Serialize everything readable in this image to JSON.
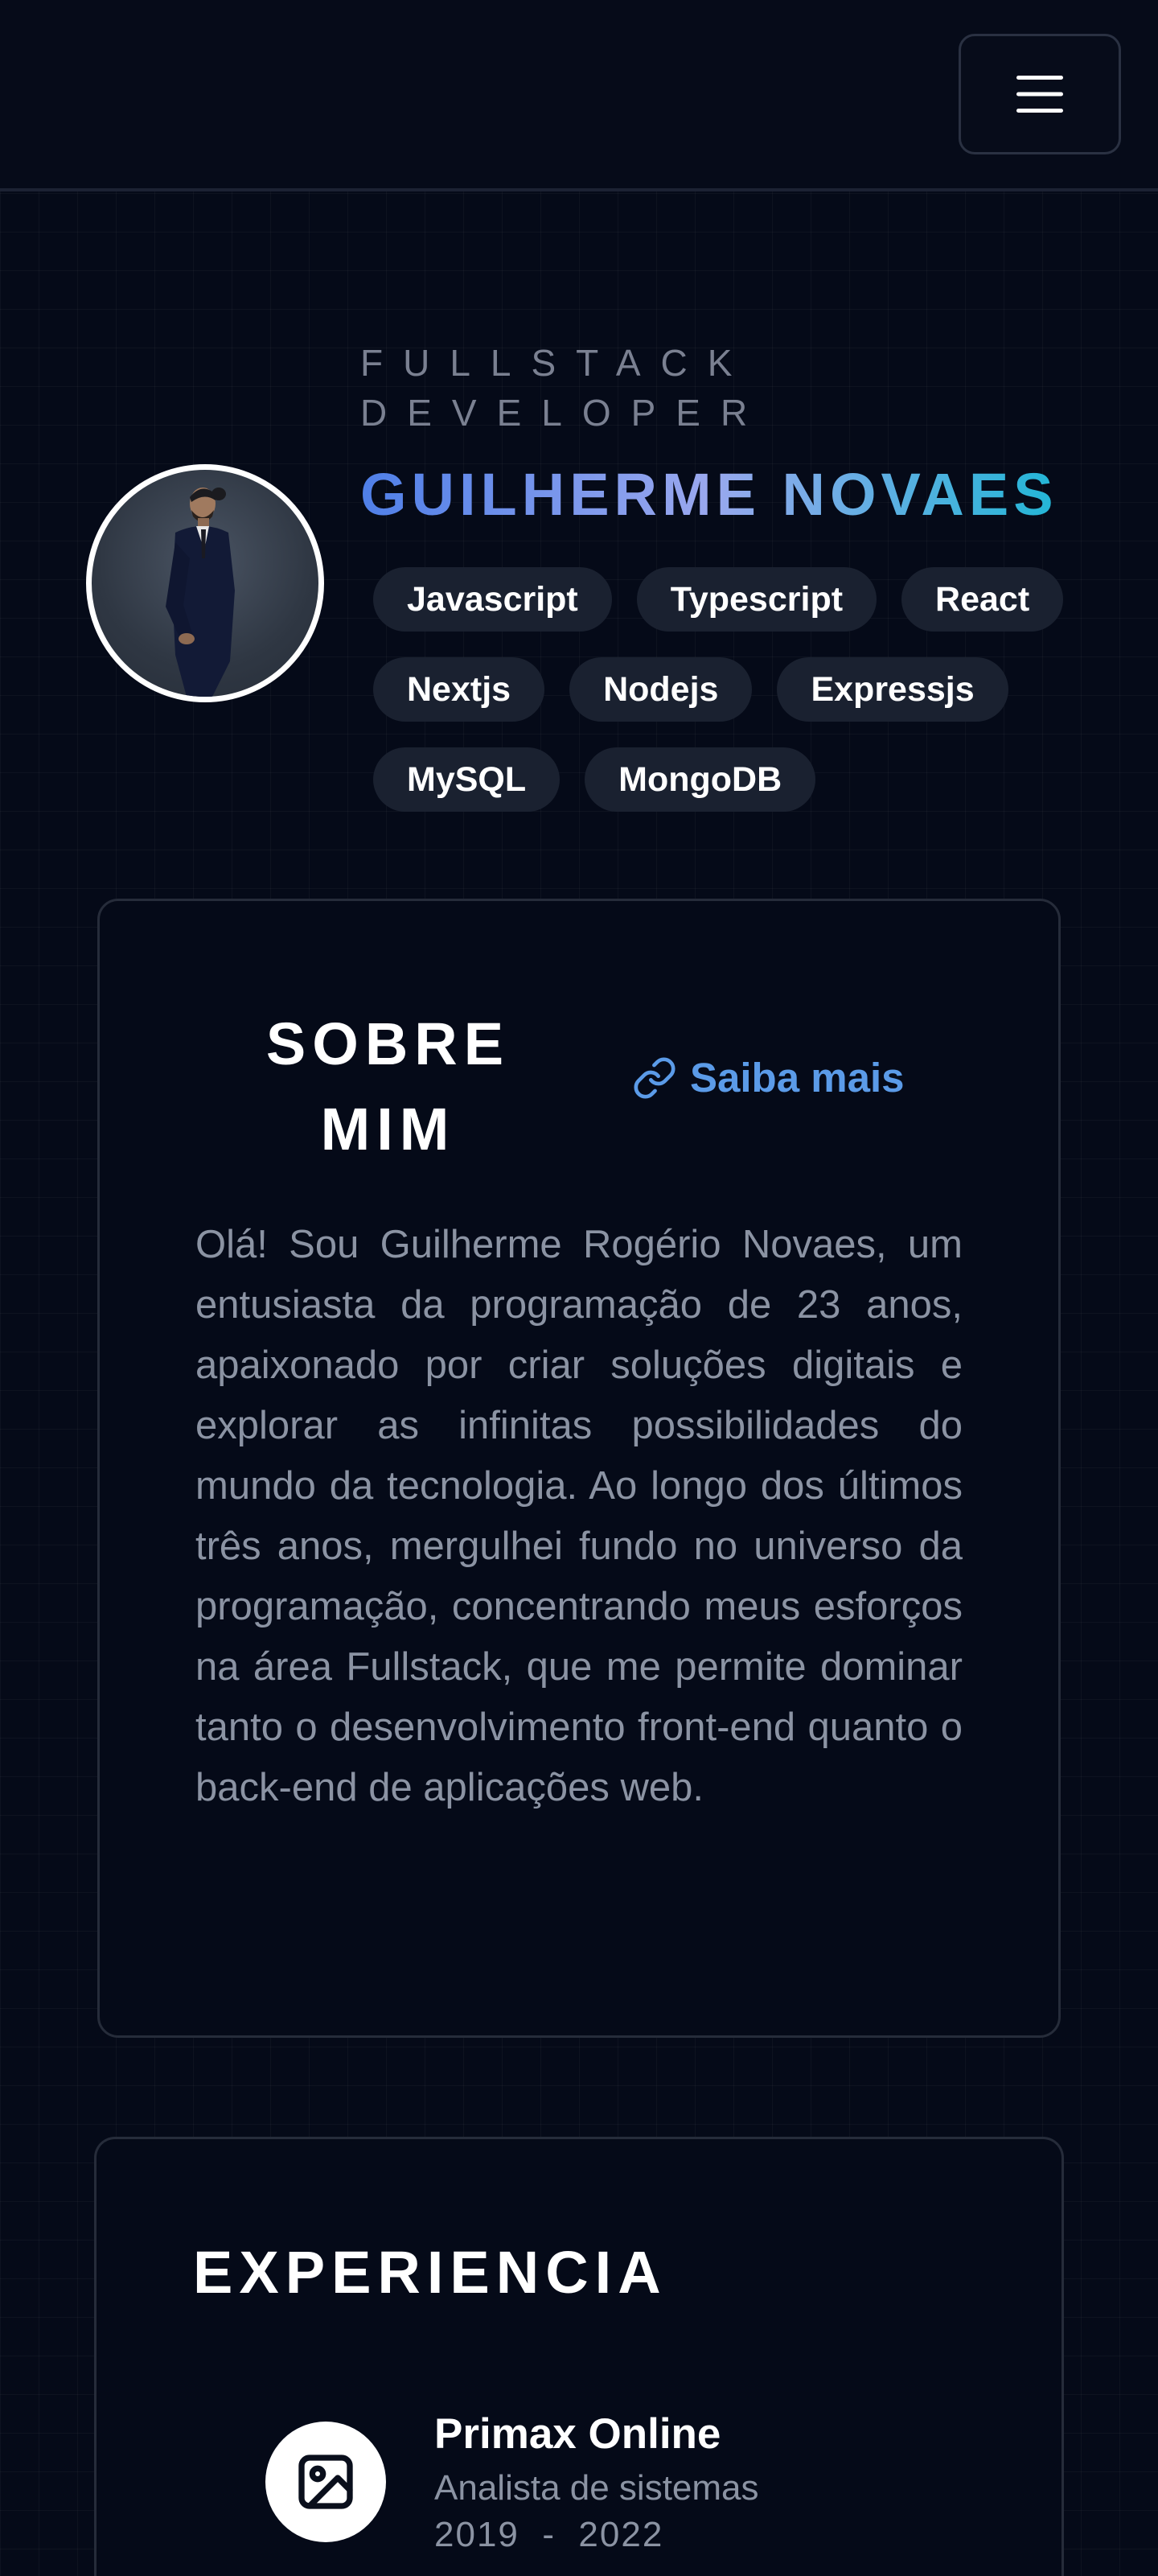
{
  "header": {
    "menu_icon": "hamburger-menu-icon"
  },
  "hero": {
    "role_line1": "FULLSTACK",
    "role_line2": "DEVELOPER",
    "name": "GUILHERME NOVAES",
    "avatar_icon": "profile-photo",
    "technologies": [
      "Javascript",
      "Typescript",
      "React",
      "Nextjs",
      "Nodejs",
      "Expressjs",
      "MySQL",
      "MongoDB"
    ]
  },
  "about": {
    "title_line1": "SOBRE",
    "title_line2": "MIM",
    "link_label": "Saiba mais",
    "link_icon": "link-icon",
    "text": "Olá! Sou Guilherme Rogério Novaes, um entusiasta da programação de 23 anos, apaixonado por criar soluções digitais e explorar as infinitas possibilidades do mundo da tecnologia. Ao longo dos últimos três anos, mergulhei fundo no universo da programação, concentrando meus esforços na área Fullstack, que me permite dominar tanto o desenvolvimento front-end quanto o back-end de aplicações web."
  },
  "experience": {
    "title": "EXPERIENCIA",
    "items": [
      {
        "company": "Primax Online",
        "role": "Analista de sistemas",
        "period": "2019  -  2022",
        "logo_icon": "image-placeholder-icon"
      }
    ]
  },
  "colors": {
    "background": "#050a18",
    "name_gradient_start": "#4f7fe8",
    "name_gradient_end": "#22b6d6",
    "link": "#5b9be8",
    "pill": "#1a2130",
    "muted_text": "#8b93a3"
  }
}
